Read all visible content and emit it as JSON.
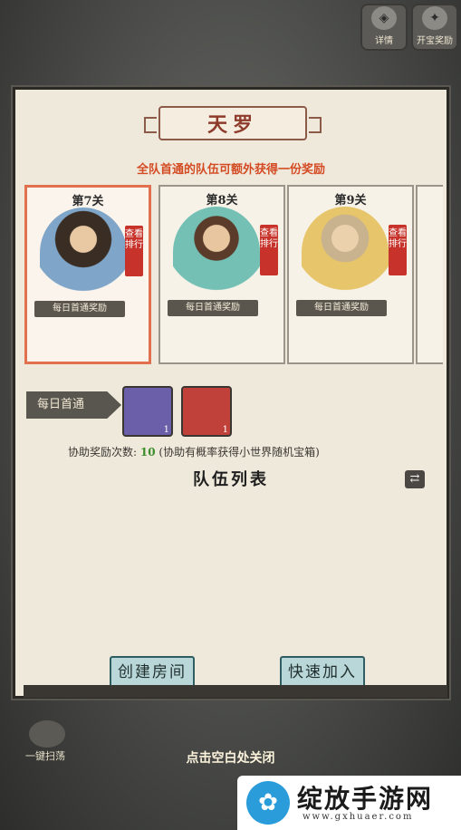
{
  "top_bar": {
    "details_label": "详情",
    "reward_label": "开宝奖励"
  },
  "dialog": {
    "title": "天罗",
    "subtitle": "全队首通的队伍可额外获得一份奖励",
    "stages": [
      {
        "no": "第7关",
        "rank_label": "查看排行",
        "award_label": "每日首通奖励",
        "selected": true
      },
      {
        "no": "第8关",
        "rank_label": "查看排行",
        "award_label": "每日首通奖励",
        "selected": false
      },
      {
        "no": "第9关",
        "rank_label": "查看排行",
        "award_label": "每日首通奖励",
        "selected": false
      }
    ],
    "daily_first": {
      "label": "每日首通",
      "items": [
        {
          "count": "1",
          "color": "#6a5fa8"
        },
        {
          "count": "1",
          "color": "#c0413a"
        }
      ]
    },
    "assist": {
      "label": "协助奖励次数:",
      "count": "10",
      "note": "(协助有概率获得小世界随机宝箱)"
    },
    "team_list_title": "队伍列表",
    "create_room_label": "创建房间",
    "quick_join_label": "快速加入"
  },
  "sweep_label": "一键扫荡",
  "close_hint": "点击空白处关闭",
  "watermark": {
    "name": "绽放手游网",
    "url": "www.gxhuaer.com"
  }
}
